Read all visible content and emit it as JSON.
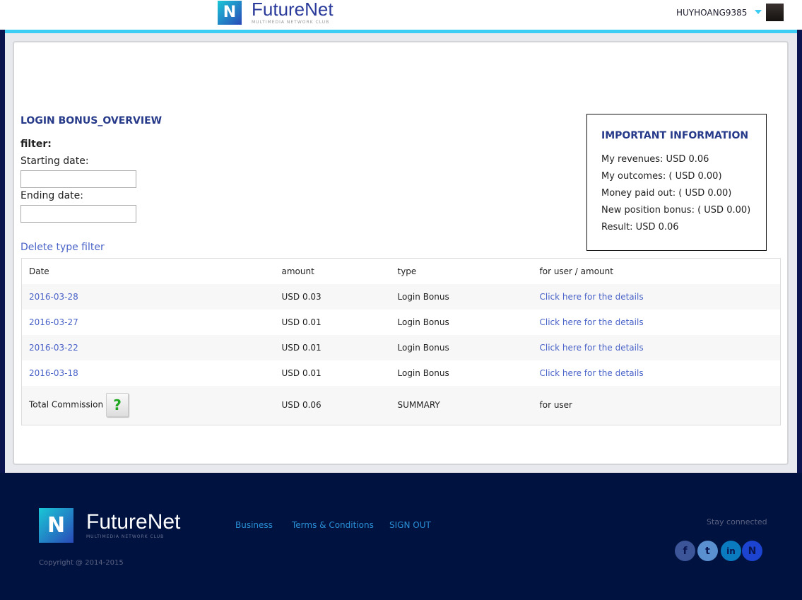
{
  "header": {
    "brand": "FutureNet",
    "tagline": "MULTIMEDIA NETWORK CLUB",
    "username": "HUYHOANG9385"
  },
  "page": {
    "title": "LOGIN BONUS_OVERVIEW",
    "filter_label": "filter:",
    "start_label": "Starting date:",
    "end_label": "Ending date:",
    "start_value": "",
    "end_value": "",
    "delete_filter": "Delete type filter"
  },
  "info": {
    "title": "IMPORTANT INFORMATION",
    "lines": [
      "My revenues: USD 0.06",
      "My outcomes: ( USD 0.00)",
      "Money paid out: ( USD 0.00)",
      "New position bonus: ( USD 0.00)",
      "Result: USD 0.06"
    ]
  },
  "table": {
    "headers": [
      "Date",
      "amount",
      "type",
      "for user / amount"
    ],
    "rows": [
      {
        "date": "2016-03-28",
        "amount": "USD 0.03",
        "type": "Login Bonus",
        "link": "Click here for the details"
      },
      {
        "date": "2016-03-27",
        "amount": "USD 0.01",
        "type": "Login Bonus",
        "link": "Click here for the details"
      },
      {
        "date": "2016-03-22",
        "amount": "USD 0.01",
        "type": "Login Bonus",
        "link": "Click here for the details"
      },
      {
        "date": "2016-03-18",
        "amount": "USD 0.01",
        "type": "Login Bonus",
        "link": "Click here for the details"
      }
    ],
    "total": {
      "label": "Total Commission",
      "help": "?",
      "amount": "USD 0.06",
      "type": "SUMMARY",
      "user": "for user"
    }
  },
  "footer": {
    "brand": "FutureNet",
    "tagline": "MULTIMEDIA NETWORK CLUB",
    "links": [
      "Business",
      "Terms & Conditions",
      "SIGN OUT"
    ],
    "copyright": "Copyright @ 2014-2015",
    "stay": "Stay connected",
    "social": [
      "facebook-icon",
      "twitter-icon",
      "linkedin-icon",
      "futurenet-icon"
    ]
  }
}
